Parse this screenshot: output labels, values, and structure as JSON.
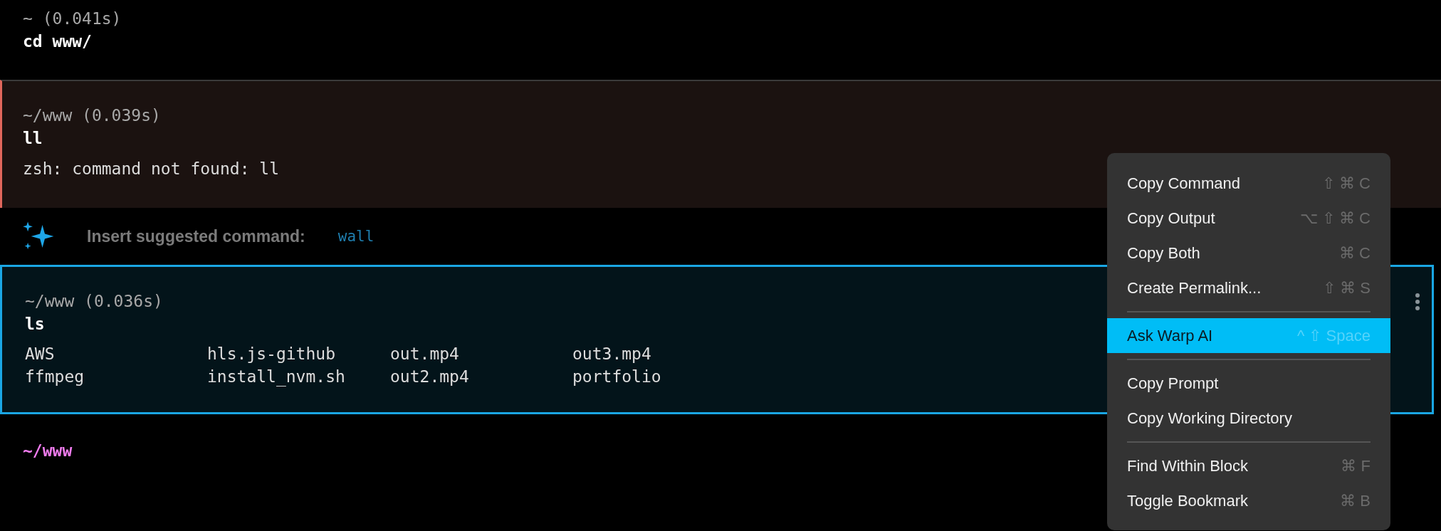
{
  "blocks": [
    {
      "prompt": "~ (0.041s)",
      "command": "cd www/",
      "error": false,
      "selected": false,
      "output": {
        "kind": "none"
      }
    },
    {
      "prompt": "~/www (0.039s)",
      "command": "ll",
      "error": true,
      "selected": false,
      "output": {
        "kind": "text",
        "lines": [
          "zsh: command not found: ll"
        ]
      }
    },
    {
      "kind": "suggestion",
      "label": "Insert suggested command:",
      "command": "wall"
    },
    {
      "prompt": "~/www (0.036s)",
      "command": "ls",
      "error": false,
      "selected": true,
      "output": {
        "kind": "columns",
        "rows": [
          [
            "AWS",
            "hls.js-github",
            "out.mp4",
            "out3.mp4"
          ],
          [
            "ffmpeg",
            "install_nvm.sh",
            "out2.mp4",
            "portfolio"
          ]
        ]
      }
    }
  ],
  "current_prompt": "~/www",
  "context_menu": {
    "items": [
      {
        "label": "Copy Command",
        "shortcut": "⇧ ⌘ C",
        "selected": false,
        "separator_before": false
      },
      {
        "label": "Copy Output",
        "shortcut": "⌥ ⇧ ⌘ C",
        "selected": false,
        "separator_before": false
      },
      {
        "label": "Copy Both",
        "shortcut": "⌘ C",
        "selected": false,
        "separator_before": false
      },
      {
        "label": "Create Permalink...",
        "shortcut": "⇧ ⌘ S",
        "selected": false,
        "separator_before": false
      },
      {
        "label": "Ask Warp AI",
        "shortcut": "^ ⇧ Space",
        "selected": true,
        "separator_before": true
      },
      {
        "label": "Copy Prompt",
        "selected": false,
        "separator_before": true
      },
      {
        "label": "Copy Working Directory",
        "selected": false,
        "separator_before": false
      },
      {
        "label": "Find Within Block",
        "shortcut": "⌘ F",
        "selected": false,
        "separator_before": true
      },
      {
        "label": "Toggle Bookmark",
        "shortcut": "⌘ B",
        "selected": false,
        "separator_before": false
      }
    ]
  }
}
